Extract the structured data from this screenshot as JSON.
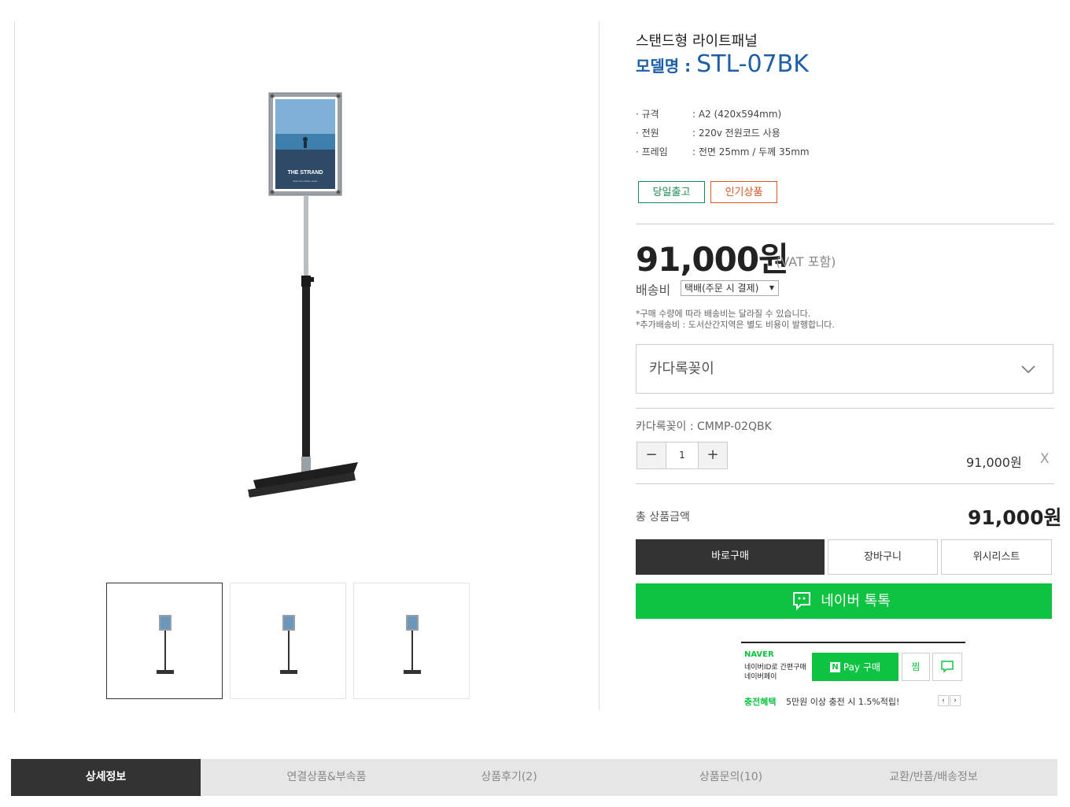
{
  "product": {
    "title": "스탠드형 라이트패널",
    "model_label": "모델명 : ",
    "model_code": "STL-07BK",
    "specs": [
      {
        "key": "· 규격",
        "value": ": A2 (420x594mm)"
      },
      {
        "key": "· 전원",
        "value": ": 220v 전원코드 사용"
      },
      {
        "key": "· 프레임",
        "value": ": 전면 25mm / 두께 35mm"
      }
    ],
    "tags": [
      {
        "label": "당일출고",
        "color": "#1a8a4b"
      },
      {
        "label": "인기상품",
        "color": "#d9541e"
      }
    ],
    "poster_text": "THE STRAND",
    "poster_subtext": "Enter the infinite ocean"
  },
  "pricing": {
    "price": "91,000원",
    "vat": "(VAT 포함)",
    "shipping_label": "배송비",
    "shipping_option": "택배(주문 시 결제)",
    "note1": "*구매 수량에 따라 배송비는 달라질 수 있습니다.",
    "note2": "*추가배송비 :  도서산간지역은 별도 비용이 발행합니다."
  },
  "option": {
    "dropdown_label": "카다록꽂이",
    "selected_name": "카다록꽂이 : CMMP-02QBK",
    "qty_minus": "−",
    "qty_value": "1",
    "qty_plus": "+",
    "line_price": "91,000원",
    "remove": "X"
  },
  "total": {
    "label": "총 상품금액",
    "value": "91,000원"
  },
  "buttons": {
    "buy": "바로구매",
    "cart": "장바구니",
    "wish": "위시리스트",
    "naver_talk": "네이버 톡톡"
  },
  "npay": {
    "brand": "NAVER",
    "desc1": "네이버ID로 간편구매",
    "desc2": "네이버페이",
    "pay_label": "Pay 구매",
    "zzim": "찜",
    "benefit_label": "충전혜택",
    "benefit_text": "5만원 이상 충전 시 1.5%적립!"
  },
  "tabs": [
    "상세정보",
    "연결상품&부속품",
    "상품후기(2)",
    "상품문의(10)",
    "교환/반품/배송정보"
  ],
  "colors": {
    "accent_blue": "#1d5ea8",
    "naver_green": "#0ec242",
    "dark": "#333333"
  }
}
